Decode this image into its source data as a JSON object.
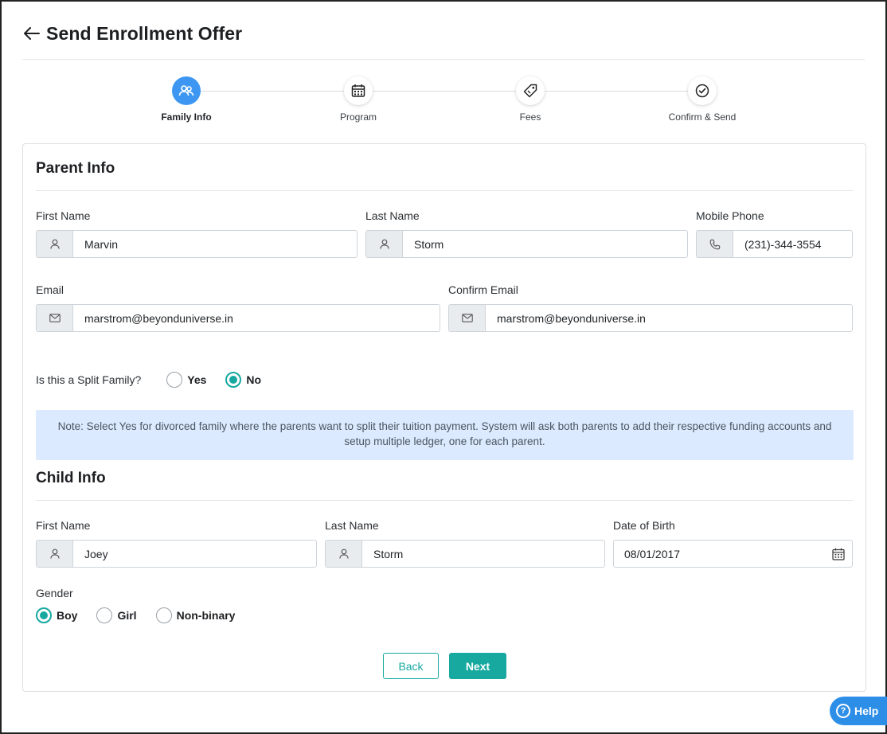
{
  "header": {
    "title": "Send Enrollment Offer",
    "back_icon": "arrow-left-icon"
  },
  "stepper": {
    "steps": [
      {
        "label": "Family Info",
        "icon": "family-icon",
        "active": true
      },
      {
        "label": "Program",
        "icon": "calendar-icon",
        "active": false
      },
      {
        "label": "Fees",
        "icon": "tag-icon",
        "active": false
      },
      {
        "label": "Confirm & Send",
        "icon": "check-circle-icon",
        "active": false
      }
    ]
  },
  "parent": {
    "title": "Parent Info",
    "first_name": {
      "label": "First Name",
      "value": "Marvin"
    },
    "last_name": {
      "label": "Last Name",
      "value": "Storm"
    },
    "mobile": {
      "label": "Mobile Phone",
      "value": "(231)-344-3554"
    },
    "email": {
      "label": "Email",
      "value": "marstrom@beyonduniverse.in"
    },
    "confirm_email": {
      "label": "Confirm Email",
      "value": "marstrom@beyonduniverse.in"
    },
    "split_family": {
      "question": "Is this a Split Family?",
      "options": [
        {
          "label": "Yes",
          "checked": false
        },
        {
          "label": "No",
          "checked": true
        }
      ]
    },
    "note": "Note: Select Yes for divorced family where the parents want to split their tuition payment. System will ask both parents to add their respective funding accounts and setup multiple ledger, one for each parent."
  },
  "child": {
    "title": "Child Info",
    "first_name": {
      "label": "First Name",
      "value": "Joey"
    },
    "last_name": {
      "label": "Last Name",
      "value": "Storm"
    },
    "dob": {
      "label": "Date of Birth",
      "value": "08/01/2017"
    },
    "gender": {
      "label": "Gender",
      "options": [
        {
          "label": "Boy",
          "checked": true
        },
        {
          "label": "Girl",
          "checked": false
        },
        {
          "label": "Non-binary",
          "checked": false
        }
      ]
    }
  },
  "actions": {
    "back_label": "Back",
    "next_label": "Next"
  },
  "help": {
    "label": "Help"
  },
  "colors": {
    "accent": "#17a9a0",
    "step_active": "#3d97f2",
    "note_bg": "#dbeafe",
    "help_bg": "#2d8ee8"
  }
}
